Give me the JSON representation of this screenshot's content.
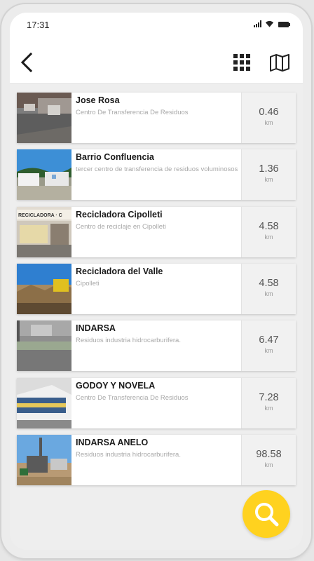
{
  "status": {
    "time": "17:31"
  },
  "header": {
    "back_icon": "chevron-left-icon",
    "grid_icon": "grid-icon",
    "map_icon": "map-icon"
  },
  "items": [
    {
      "title": "Jose Rosa",
      "subtitle": "Centro De Transferencia De Residuos",
      "distance": "0.46",
      "unit": "km"
    },
    {
      "title": "Barrio Confluencia",
      "subtitle": "tercer centro de transferencia de residuos voluminosos",
      "distance": "1.36",
      "unit": "km"
    },
    {
      "title": "Recicladora Cipolleti",
      "subtitle": "Centro de reciclaje en Cipolleti",
      "distance": "4.58",
      "unit": "km"
    },
    {
      "title": "Recicladora del Valle",
      "subtitle": "Cipolleti",
      "distance": "4.58",
      "unit": "km"
    },
    {
      "title": "INDARSA",
      "subtitle": "Residuos industria hidrocarburifera.",
      "distance": "6.47",
      "unit": "km"
    },
    {
      "title": "GODOY Y NOVELA",
      "subtitle": "Centro De Transferencia De Residuos",
      "distance": "7.28",
      "unit": "km"
    },
    {
      "title": "INDARSA ANELO",
      "subtitle": "Residuos industria hidrocarburifera.",
      "distance": "98.58",
      "unit": "km"
    }
  ],
  "thumb_texts": {
    "sign": "RECICLADORA · C"
  },
  "fab": {
    "icon": "search-icon",
    "color": "#ffd21f"
  }
}
